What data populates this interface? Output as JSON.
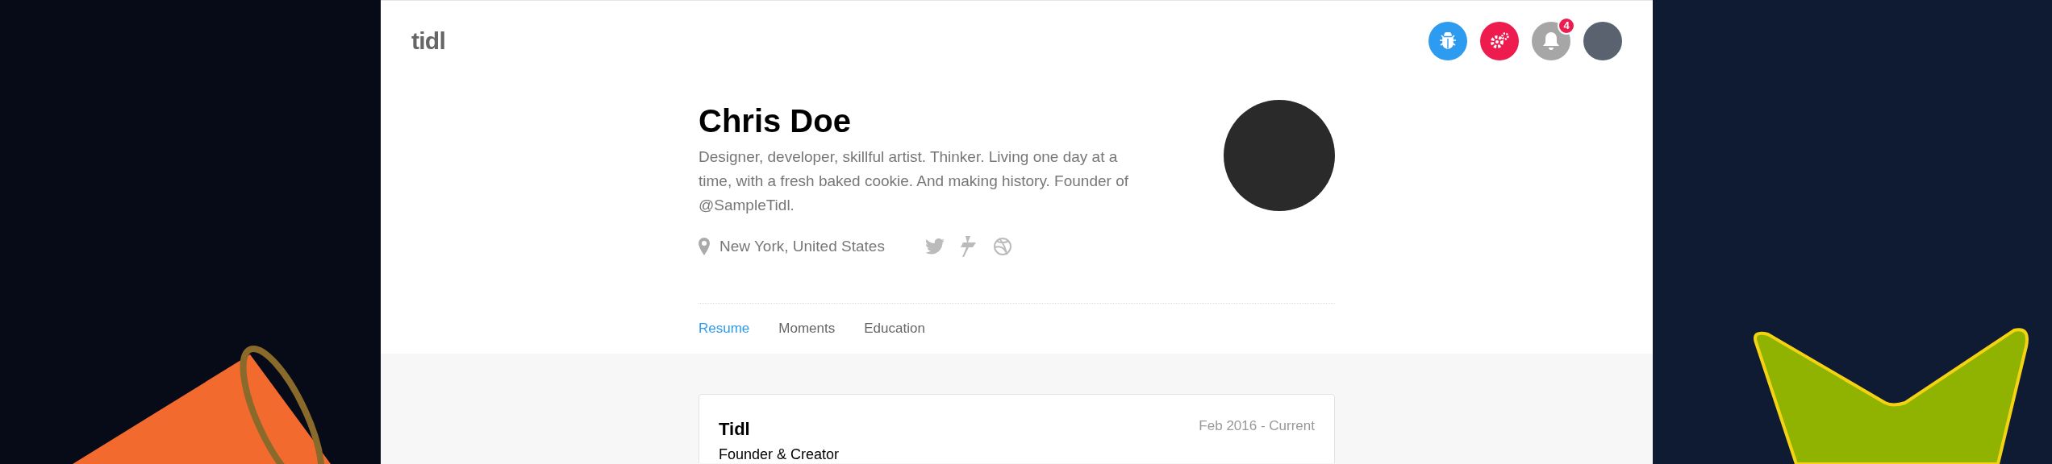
{
  "header": {
    "logo": "tidl",
    "actions": [
      {
        "kind": "bug",
        "color": "#2d9bf0"
      },
      {
        "kind": "gears",
        "color": "#ee1c4e"
      },
      {
        "kind": "bell",
        "color": "#a6a6a6",
        "badge": "4"
      }
    ]
  },
  "profile": {
    "name": "Chris Doe",
    "bio": "Designer, developer, skillful artist. Thinker. Living one day at a time, with a fresh baked cookie. And making history. Founder of @SampleTidl.",
    "location": "New York, United States"
  },
  "tabs": [
    {
      "label": "Resume",
      "selected": true
    },
    {
      "label": "Moments",
      "selected": false
    },
    {
      "label": "Education",
      "selected": false
    }
  ],
  "experience": [
    {
      "company": "Tidl",
      "role": "Founder & Creator",
      "dates": "Feb 2016 - Current"
    }
  ]
}
